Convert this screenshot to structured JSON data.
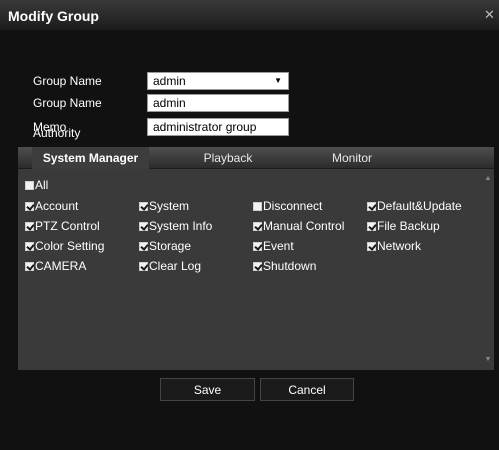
{
  "dialog": {
    "title": "Modify Group",
    "close_glyph": "✕"
  },
  "fields": {
    "group_name_select": {
      "label": "Group Name",
      "value": "admin"
    },
    "group_name_text": {
      "label": "Group Name",
      "value": "admin"
    },
    "memo": {
      "label": "Memo",
      "value": "administrator group"
    },
    "authority_label": "Authority"
  },
  "tabs": [
    {
      "label": "System Manager",
      "active": true
    },
    {
      "label": "Playback",
      "active": false
    },
    {
      "label": "Monitor",
      "active": false
    }
  ],
  "permissions": {
    "all": {
      "label": "All",
      "checked": false
    },
    "items": [
      {
        "label": "Account",
        "checked": true
      },
      {
        "label": "System",
        "checked": true
      },
      {
        "label": "Disconnect",
        "checked": false
      },
      {
        "label": "Default&Update",
        "checked": true
      },
      {
        "label": "PTZ Control",
        "checked": true
      },
      {
        "label": "System Info",
        "checked": true
      },
      {
        "label": "Manual Control",
        "checked": true
      },
      {
        "label": "File Backup",
        "checked": true
      },
      {
        "label": "Color Setting",
        "checked": true
      },
      {
        "label": "Storage",
        "checked": true
      },
      {
        "label": "Event",
        "checked": true
      },
      {
        "label": "Network",
        "checked": true
      },
      {
        "label": "CAMERA",
        "checked": true
      },
      {
        "label": "Clear Log",
        "checked": true
      },
      {
        "label": "Shutdown",
        "checked": true
      }
    ]
  },
  "buttons": {
    "save": "Save",
    "cancel": "Cancel"
  }
}
